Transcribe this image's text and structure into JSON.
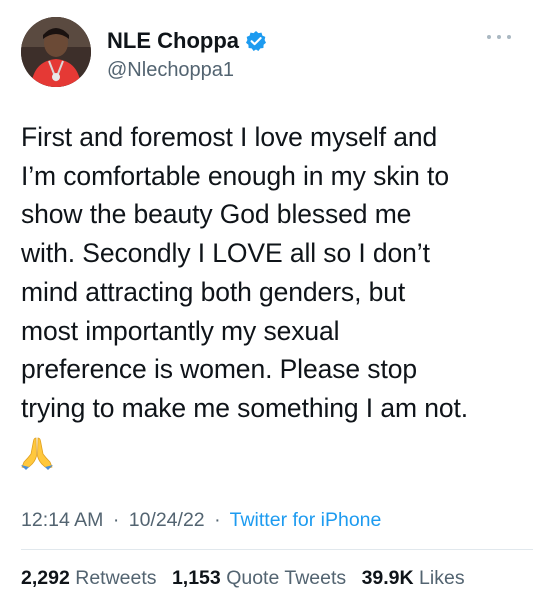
{
  "author": {
    "display_name": "NLE Choppa",
    "handle": "@Nlechoppa1",
    "verified": true
  },
  "tweet": {
    "text": "First and foremost I love myself and\nI’m comfortable enough in my skin to\nshow the beauty God blessed me\nwith. Secondly I LOVE all so I don’t\nmind attracting both genders, but\nmost importantly my sexual\npreference is women. Please stop\ntrying to make me something I am not.",
    "emoji": "folded-hands-icon",
    "time": "12:14 AM",
    "date": "10/24/22",
    "separator": "·",
    "source": "Twitter for iPhone"
  },
  "stats": {
    "retweets_count": "2,292",
    "retweets_label": "Retweets",
    "quotes_count": "1,153",
    "quotes_label": "Quote Tweets",
    "likes_count": "39.9K",
    "likes_label": "Likes"
  },
  "colors": {
    "text_primary": "#0f1419",
    "text_secondary": "#536471",
    "link": "#1d9bf0",
    "verified_badge": "#1d9bf0",
    "divider": "#e1e8ed"
  },
  "icons": {
    "verified": "verified-badge-icon",
    "more": "more-options-icon"
  }
}
